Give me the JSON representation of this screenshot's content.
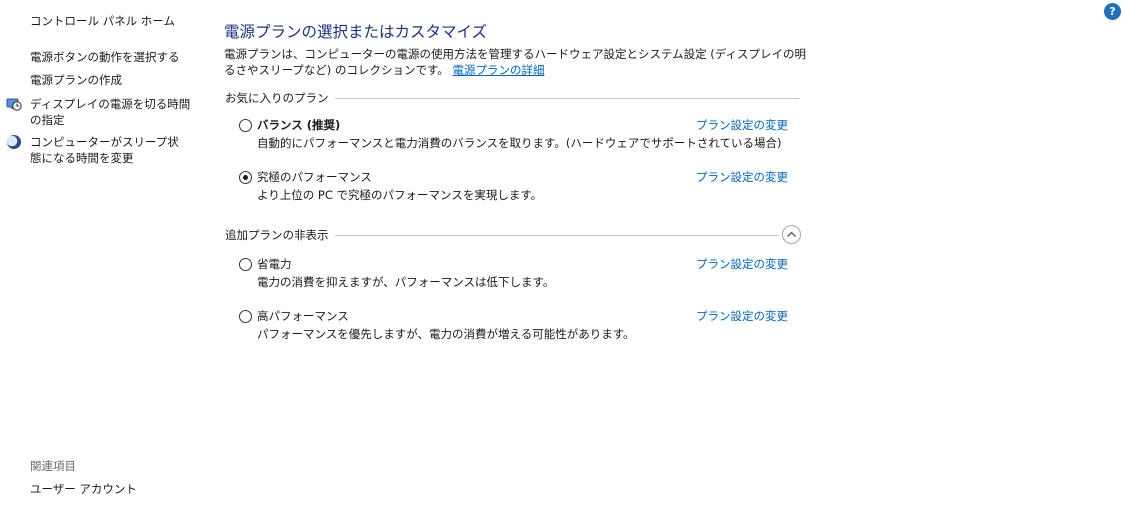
{
  "sidebar": {
    "home": "コントロール パネル ホーム",
    "links": [
      "電源ボタンの動作を選択する",
      "電源プランの作成",
      "ディスプレイの電源を切る時間の指定",
      "コンピューターがスリープ状態になる時間を変更"
    ],
    "icons": [
      "display-clock-icon",
      "moon-icon"
    ],
    "related_title": "関連項目",
    "related_links": [
      "ユーザー アカウント"
    ]
  },
  "help": {
    "label": "?",
    "icon": "help-icon",
    "color": "#1f6fc5"
  },
  "main": {
    "title": "電源プランの選択またはカスタマイズ",
    "description": "電源プランは、コンピューターの電源の使用方法を管理するハードウェア設定とシステム設定 (ディスプレイの明るさやスリープなど) のコレクションです。",
    "details_link": "電源プランの詳細",
    "favorites_label": "お気に入りのプラン",
    "favorite_plans": [
      {
        "name": "バランス (推奨)",
        "description": "自動的にパフォーマンスと電力消費のバランスを取ります。(ハードウェアでサポートされている場合)",
        "link": "プラン設定の変更",
        "selected": false,
        "bold": true
      },
      {
        "name": "究極のパフォーマンス",
        "description": "より上位の PC で究極のパフォーマンスを実現します。",
        "link": "プラン設定の変更",
        "selected": true,
        "bold": false
      }
    ],
    "hidden_label": "追加プランの非表示",
    "collapse_icon": "chevron-up-circle-icon",
    "hidden_plans": [
      {
        "name": "省電力",
        "description": "電力の消費を抑えますが、パフォーマンスは低下します。",
        "link": "プラン設定の変更",
        "selected": false
      },
      {
        "name": "高パフォーマンス",
        "description": "パフォーマンスを優先しますが、電力の消費が増える可能性があります。",
        "link": "プラン設定の変更",
        "selected": false
      }
    ]
  },
  "colors": {
    "title": "#1e3287",
    "link": "#0066cc",
    "muted": "#6d6d6d"
  }
}
